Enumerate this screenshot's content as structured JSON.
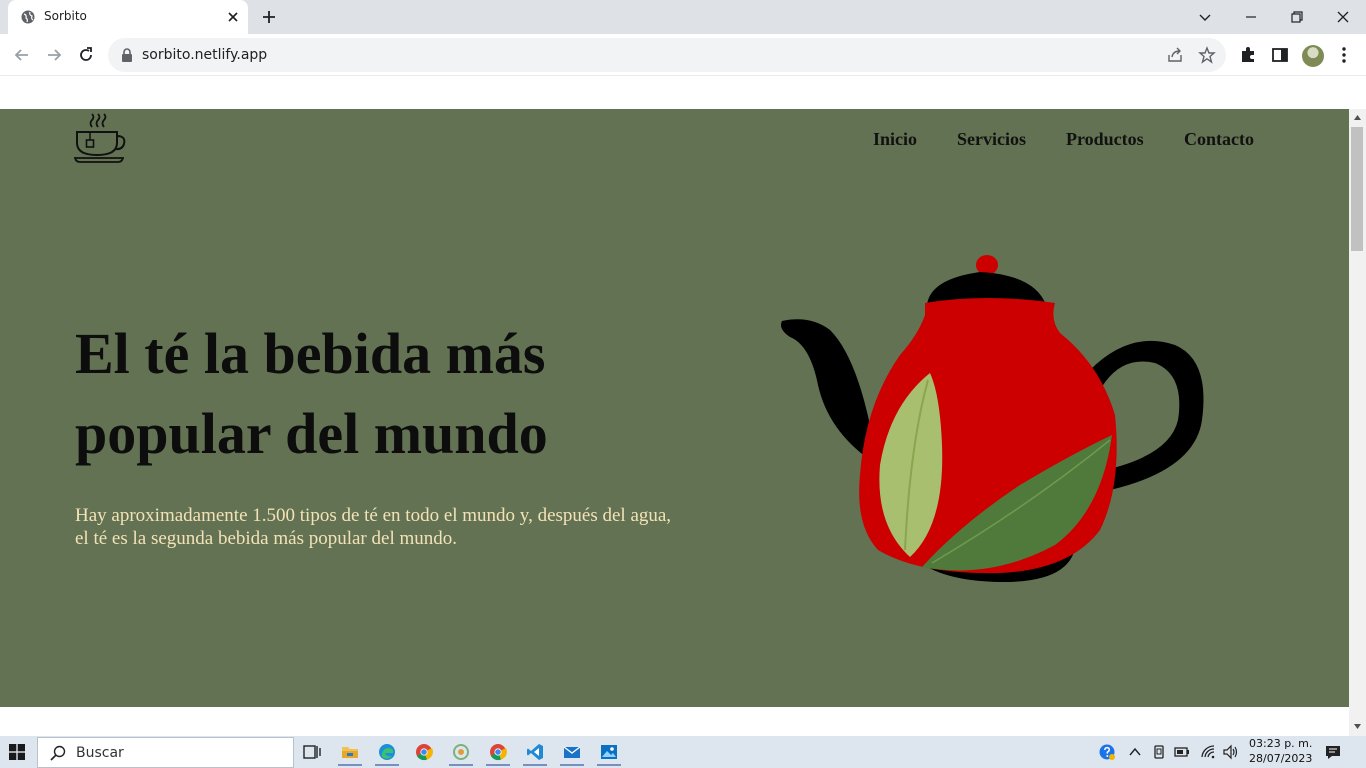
{
  "browser": {
    "tab_title": "Sorbito",
    "url": "sorbito.netlify.app"
  },
  "site": {
    "nav": [
      "Inicio",
      "Servicios",
      "Productos",
      "Contacto"
    ],
    "headline": "El té la bebida más popular del mundo",
    "subtext": "Hay aproximadamente 1.500 tipos de té en todo el mundo y, después del agua, el té es la segunda bebida más popular del mundo.",
    "colors": {
      "background": "#627252",
      "headline": "#0d0d0d",
      "subtext": "#f3e2b8",
      "teapot_body": "#cc0000",
      "teapot_lid": "#000000"
    }
  },
  "taskbar": {
    "search_placeholder": "Buscar",
    "time": "03:23 p. m.",
    "date": "28/07/2023"
  },
  "icons": [
    "globe-icon",
    "close-icon",
    "plus-icon",
    "chevron-down-icon",
    "minimize-icon",
    "restore-icon",
    "back-icon",
    "forward-icon",
    "reload-icon",
    "lock-icon",
    "share-icon",
    "star-icon",
    "extensions-icon",
    "sidepanel-icon",
    "more-icon",
    "tea-cup-logo-icon",
    "windows-start-icon",
    "search-icon",
    "task-view-icon",
    "file-explorer-icon",
    "edge-icon",
    "chrome-icon",
    "vscode-icon",
    "mail-icon",
    "photos-icon",
    "help-icon",
    "chevron-up-icon",
    "battery-icon",
    "wifi-icon",
    "volume-icon",
    "notifications-icon"
  ]
}
